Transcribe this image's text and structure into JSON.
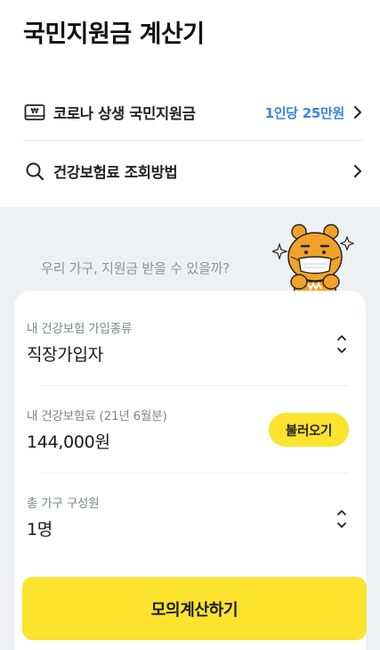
{
  "header": {
    "title": "국민지원금 계산기"
  },
  "rows": [
    {
      "label": "코로나 상생 국민지원금",
      "value": "1인당 25만원",
      "icon": "banknote-icon"
    },
    {
      "label": "건강보험료 조회방법",
      "icon": "search-icon"
    }
  ],
  "prompt": "우리 가구, 지원금 받을 수 있을까?",
  "mascot": "ryan-mascot-with-mask",
  "form": {
    "insurance_type": {
      "label": "내 건강보험 가입종류",
      "value": "직장가입자"
    },
    "premium": {
      "label": "내 건강보험료 (21년 6월분)",
      "value": "144,000원",
      "button": "불러오기"
    },
    "household": {
      "label": "총 가구 구성원",
      "value": "1명"
    }
  },
  "submit_label": "모의계산하기",
  "colors": {
    "accent_yellow": "#fbe32e",
    "link_blue": "#3a86e0",
    "background_gray": "#eef1f4"
  }
}
